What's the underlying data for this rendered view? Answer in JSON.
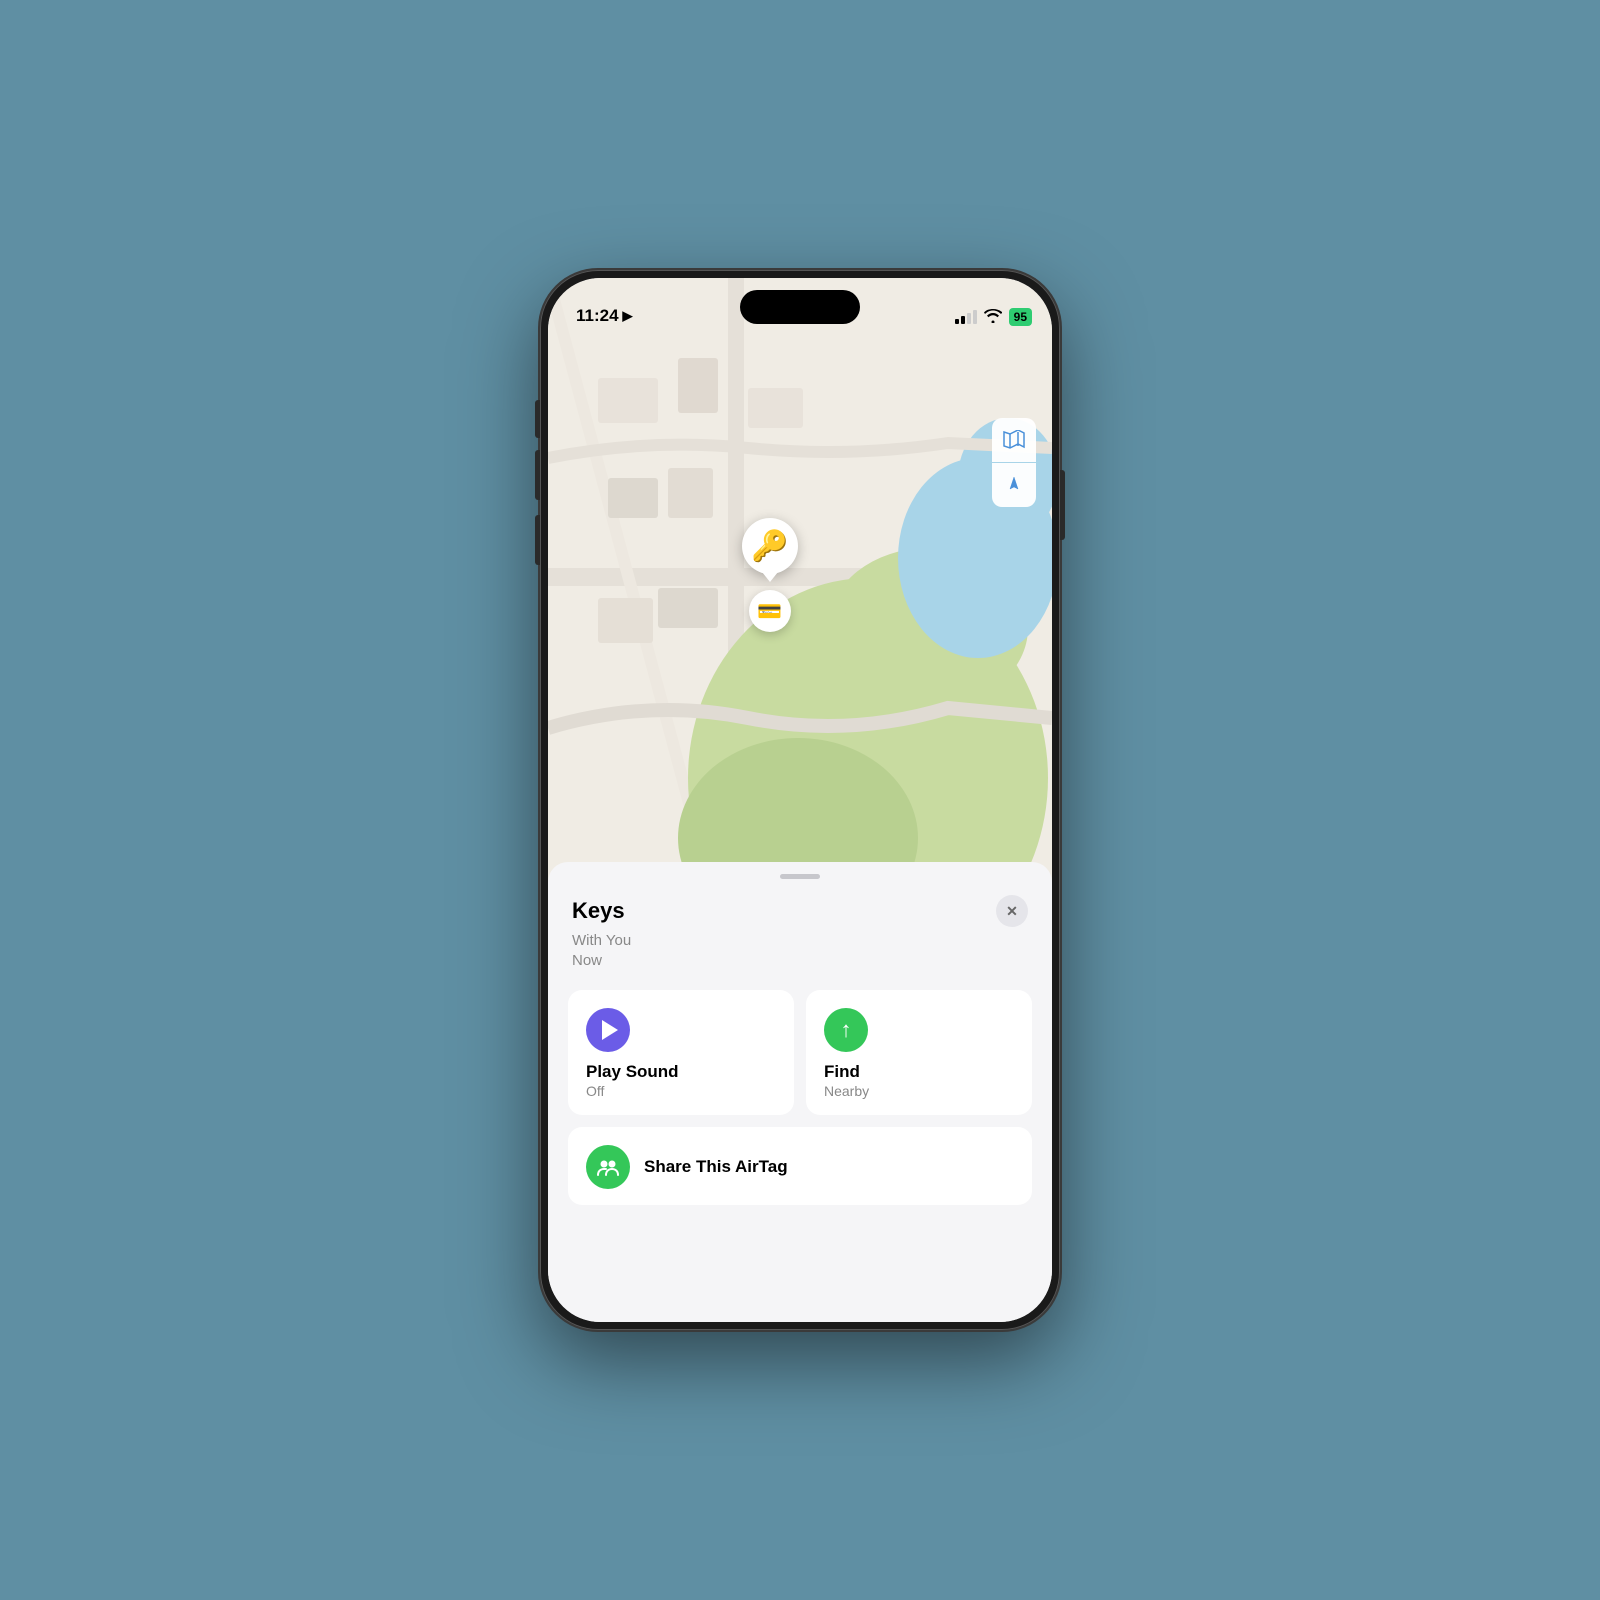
{
  "phone": {
    "status_bar": {
      "time": "11:24",
      "battery": "95"
    },
    "map": {
      "pin_emoji": "🔑",
      "wallet_emoji": "💳",
      "map_btn_1": "🗺",
      "map_btn_2": "➤"
    },
    "sheet": {
      "title": "Keys",
      "subtitle_line1": "With You",
      "subtitle_line2": "Now",
      "close_label": "✕",
      "action1_label": "Play Sound",
      "action1_sublabel": "Off",
      "action2_label": "Find",
      "action2_sublabel": "Nearby",
      "action3_label": "Share This AirTag"
    }
  }
}
